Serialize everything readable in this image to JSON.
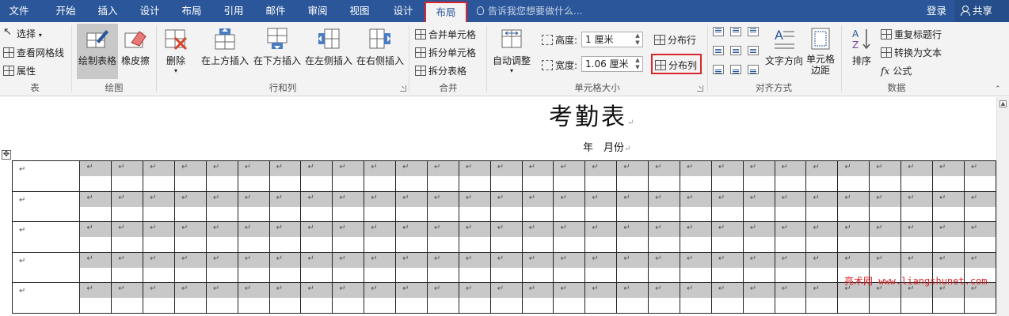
{
  "tabs": [
    "文件",
    "开始",
    "插入",
    "设计",
    "布局",
    "引用",
    "邮件",
    "审阅",
    "视图",
    "设计",
    "布局"
  ],
  "active_tab_index": 10,
  "tell_me": "告诉我您想要做什么...",
  "account": {
    "login": "登录",
    "share": "共享"
  },
  "ribbon": {
    "table_group": {
      "label": "表",
      "select": "选择",
      "view_gridlines": "查看网格线",
      "properties": "属性"
    },
    "draw_group": {
      "label": "绘图",
      "draw_table": "绘制表格",
      "eraser": "橡皮擦"
    },
    "rows_cols_group": {
      "label": "行和列",
      "delete": "删除",
      "insert_above": "在上方插入",
      "insert_below": "在下方插入",
      "insert_left": "在左侧插入",
      "insert_right": "在右侧插入"
    },
    "merge_group": {
      "label": "合并",
      "merge_cells": "合并单元格",
      "split_cells": "拆分单元格",
      "split_table": "拆分表格"
    },
    "cell_size_group": {
      "label": "单元格大小",
      "autofit": "自动调整",
      "height_label": "高度:",
      "height_value": "1 厘米",
      "width_label": "宽度:",
      "width_value": "1.06 厘米",
      "distribute_rows": "分布行",
      "distribute_cols": "分布列"
    },
    "alignment_group": {
      "label": "对齐方式",
      "text_direction": "文字方向",
      "cell_margins_1": "单元格",
      "cell_margins_2": "边距"
    },
    "data_group": {
      "label": "数据",
      "sort": "排序",
      "repeat_header": "重复标题行",
      "convert_text": "转换为文本",
      "formula": "公式"
    }
  },
  "document": {
    "title": "考勤表",
    "subtitle": "年　月份",
    "paragraph_mark": "↵",
    "table": {
      "rows": 5,
      "cols": 30
    }
  },
  "watermark": "亮术网 www.liangshunet.com"
}
